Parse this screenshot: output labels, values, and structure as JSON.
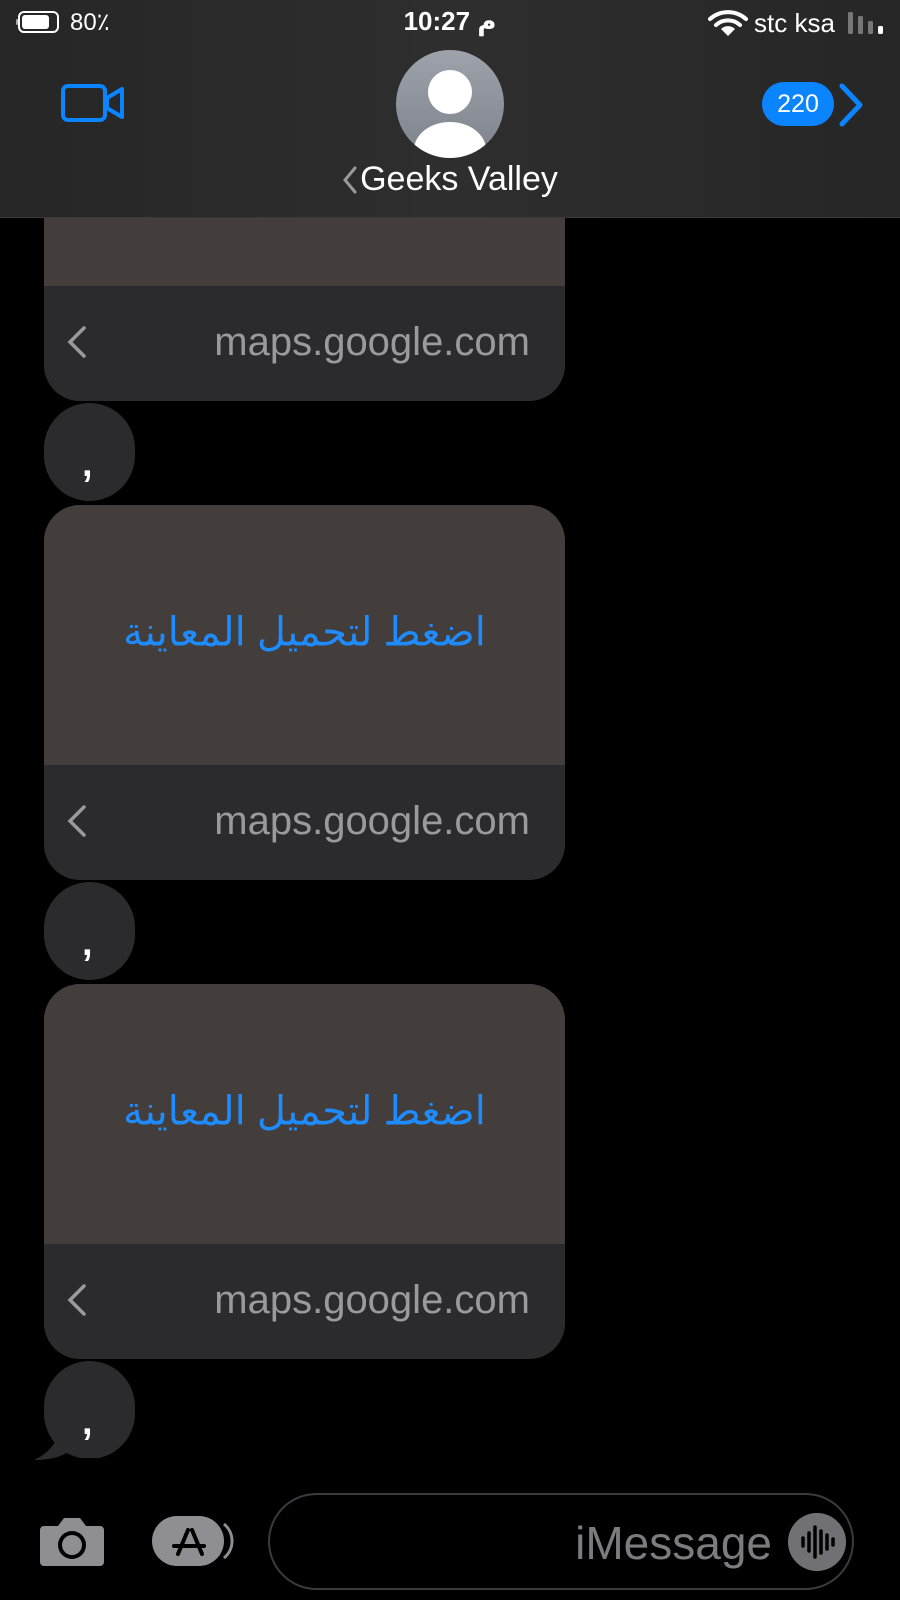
{
  "status_bar": {
    "battery_percent": "80٪",
    "time": "10:27 م",
    "carrier": "stc ksa"
  },
  "header": {
    "contact_name": "Geeks Valley",
    "badge_count": "220"
  },
  "messages": [
    {
      "type": "link",
      "preview_label": "",
      "domain": "maps.google.com"
    },
    {
      "type": "text",
      "text": ","
    },
    {
      "type": "link",
      "preview_label": "اضغط لتحميل المعاينة",
      "domain": "maps.google.com"
    },
    {
      "type": "text",
      "text": ","
    },
    {
      "type": "link",
      "preview_label": "اضغط لتحميل المعاينة",
      "domain": "maps.google.com"
    },
    {
      "type": "text",
      "text": ","
    }
  ],
  "input_bar": {
    "placeholder": "iMessage",
    "value": ""
  },
  "icons": [
    "battery-icon",
    "wifi-icon",
    "signal-icon",
    "video-camera-icon",
    "avatar-person-icon",
    "chevron-left-icon",
    "chevron-right-icon",
    "camera-icon",
    "app-store-icon",
    "audio-waveform-icon"
  ],
  "colors": {
    "accent": "#0a84ff",
    "bubble": "#2b2b2d",
    "preview": "#433d3b",
    "link_text": "#1e8cff"
  }
}
